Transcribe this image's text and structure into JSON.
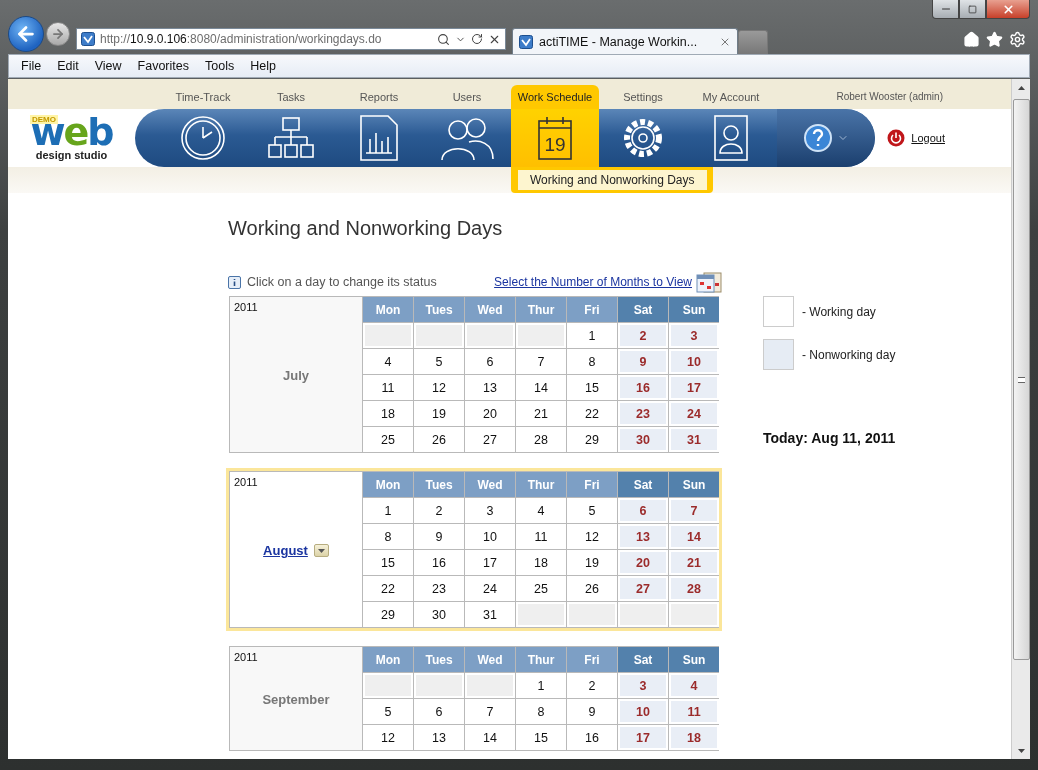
{
  "window": {
    "controls": [
      {
        "kind": "minimize"
      },
      {
        "kind": "maximize"
      },
      {
        "kind": "close"
      }
    ]
  },
  "browser": {
    "address": {
      "scheme": "http://",
      "host": "10.9.0.106",
      "path": ":8080/administration/workingdays.do"
    },
    "tabs": [
      {
        "title": "actiTIME - Manage Workin...",
        "selected": true
      }
    ],
    "menu": [
      "File",
      "Edit",
      "View",
      "Favorites",
      "Tools",
      "Help"
    ]
  },
  "app": {
    "logo": {
      "badge": "DEMO",
      "wordmark": "web",
      "subtitle": "design studio"
    },
    "nav": [
      {
        "label": "Time-Track",
        "kind": "clock",
        "selected": false
      },
      {
        "label": "Tasks",
        "kind": "hierarchy",
        "selected": false
      },
      {
        "label": "Reports",
        "kind": "chart",
        "selected": false
      },
      {
        "label": "Users",
        "kind": "people",
        "selected": false
      },
      {
        "label": "Work Schedule",
        "kind": "calendar",
        "icon_text": "19",
        "selected": true
      },
      {
        "label": "Settings",
        "kind": "gear",
        "selected": false
      },
      {
        "label": "My Account",
        "kind": "contact",
        "selected": false
      }
    ],
    "user": "Robert Wooster (admin)",
    "logout": "Logout",
    "submenu": "Working and Nonworking Days"
  },
  "page": {
    "title": "Working and Nonworking Days",
    "hint": "Click on a day to change its status",
    "months_link": "Select the Number of Months to View",
    "months": [
      {
        "year": "2011",
        "name": "July",
        "selected": false,
        "weekdays": [
          {
            "label": "Mon",
            "weekend": false
          },
          {
            "label": "Tues",
            "weekend": false
          },
          {
            "label": "Wed",
            "weekend": false
          },
          {
            "label": "Thur",
            "weekend": false
          },
          {
            "label": "Fri",
            "weekend": false
          },
          {
            "label": "Sat",
            "weekend": true
          },
          {
            "label": "Sun",
            "weekend": true
          }
        ],
        "weeks": [
          [
            {
              "kind": "blank"
            },
            {
              "kind": "blank"
            },
            {
              "kind": "blank"
            },
            {
              "kind": "blank"
            },
            {
              "kind": "day",
              "day": "1",
              "working": true
            },
            {
              "kind": "day",
              "day": "2",
              "working": false
            },
            {
              "kind": "day",
              "day": "3",
              "working": false
            }
          ],
          [
            {
              "kind": "day",
              "day": "4",
              "working": true
            },
            {
              "kind": "day",
              "day": "5",
              "working": true
            },
            {
              "kind": "day",
              "day": "6",
              "working": true
            },
            {
              "kind": "day",
              "day": "7",
              "working": true
            },
            {
              "kind": "day",
              "day": "8",
              "working": true
            },
            {
              "kind": "day",
              "day": "9",
              "working": false
            },
            {
              "kind": "day",
              "day": "10",
              "working": false
            }
          ],
          [
            {
              "kind": "day",
              "day": "11",
              "working": true
            },
            {
              "kind": "day",
              "day": "12",
              "working": true
            },
            {
              "kind": "day",
              "day": "13",
              "working": true
            },
            {
              "kind": "day",
              "day": "14",
              "working": true
            },
            {
              "kind": "day",
              "day": "15",
              "working": true
            },
            {
              "kind": "day",
              "day": "16",
              "working": false
            },
            {
              "kind": "day",
              "day": "17",
              "working": false
            }
          ],
          [
            {
              "kind": "day",
              "day": "18",
              "working": true
            },
            {
              "kind": "day",
              "day": "19",
              "working": true
            },
            {
              "kind": "day",
              "day": "20",
              "working": true
            },
            {
              "kind": "day",
              "day": "21",
              "working": true
            },
            {
              "kind": "day",
              "day": "22",
              "working": true
            },
            {
              "kind": "day",
              "day": "23",
              "working": false
            },
            {
              "kind": "day",
              "day": "24",
              "working": false
            }
          ],
          [
            {
              "kind": "day",
              "day": "25",
              "working": true
            },
            {
              "kind": "day",
              "day": "26",
              "working": true
            },
            {
              "kind": "day",
              "day": "27",
              "working": true
            },
            {
              "kind": "day",
              "day": "28",
              "working": true
            },
            {
              "kind": "day",
              "day": "29",
              "working": true
            },
            {
              "kind": "day",
              "day": "30",
              "working": false
            },
            {
              "kind": "day",
              "day": "31",
              "working": false
            }
          ]
        ]
      },
      {
        "year": "2011",
        "name": "August",
        "selected": true,
        "weekdays": [
          {
            "label": "Mon",
            "weekend": false
          },
          {
            "label": "Tues",
            "weekend": false
          },
          {
            "label": "Wed",
            "weekend": false
          },
          {
            "label": "Thur",
            "weekend": false
          },
          {
            "label": "Fri",
            "weekend": false
          },
          {
            "label": "Sat",
            "weekend": true
          },
          {
            "label": "Sun",
            "weekend": true
          }
        ],
        "weeks": [
          [
            {
              "kind": "day",
              "day": "1",
              "working": true
            },
            {
              "kind": "day",
              "day": "2",
              "working": true
            },
            {
              "kind": "day",
              "day": "3",
              "working": true
            },
            {
              "kind": "day",
              "day": "4",
              "working": true
            },
            {
              "kind": "day",
              "day": "5",
              "working": true
            },
            {
              "kind": "day",
              "day": "6",
              "working": false
            },
            {
              "kind": "day",
              "day": "7",
              "working": false
            }
          ],
          [
            {
              "kind": "day",
              "day": "8",
              "working": true
            },
            {
              "kind": "day",
              "day": "9",
              "working": true
            },
            {
              "kind": "day",
              "day": "10",
              "working": true
            },
            {
              "kind": "day",
              "day": "11",
              "working": true
            },
            {
              "kind": "day",
              "day": "12",
              "working": true
            },
            {
              "kind": "day",
              "day": "13",
              "working": false
            },
            {
              "kind": "day",
              "day": "14",
              "working": false
            }
          ],
          [
            {
              "kind": "day",
              "day": "15",
              "working": true
            },
            {
              "kind": "day",
              "day": "16",
              "working": true
            },
            {
              "kind": "day",
              "day": "17",
              "working": true
            },
            {
              "kind": "day",
              "day": "18",
              "working": true
            },
            {
              "kind": "day",
              "day": "19",
              "working": true
            },
            {
              "kind": "day",
              "day": "20",
              "working": false
            },
            {
              "kind": "day",
              "day": "21",
              "working": false
            }
          ],
          [
            {
              "kind": "day",
              "day": "22",
              "working": true
            },
            {
              "kind": "day",
              "day": "23",
              "working": true
            },
            {
              "kind": "day",
              "day": "24",
              "working": true
            },
            {
              "kind": "day",
              "day": "25",
              "working": true
            },
            {
              "kind": "day",
              "day": "26",
              "working": true
            },
            {
              "kind": "day",
              "day": "27",
              "working": false
            },
            {
              "kind": "day",
              "day": "28",
              "working": false
            }
          ],
          [
            {
              "kind": "day",
              "day": "29",
              "working": true
            },
            {
              "kind": "day",
              "day": "30",
              "working": true
            },
            {
              "kind": "day",
              "day": "31",
              "working": true
            },
            {
              "kind": "blank"
            },
            {
              "kind": "blank"
            },
            {
              "kind": "blank"
            },
            {
              "kind": "blank"
            }
          ]
        ]
      },
      {
        "year": "2011",
        "name": "September",
        "selected": false,
        "weekdays": [
          {
            "label": "Mon",
            "weekend": false
          },
          {
            "label": "Tues",
            "weekend": false
          },
          {
            "label": "Wed",
            "weekend": false
          },
          {
            "label": "Thur",
            "weekend": false
          },
          {
            "label": "Fri",
            "weekend": false
          },
          {
            "label": "Sat",
            "weekend": true
          },
          {
            "label": "Sun",
            "weekend": true
          }
        ],
        "weeks": [
          [
            {
              "kind": "blank"
            },
            {
              "kind": "blank"
            },
            {
              "kind": "blank"
            },
            {
              "kind": "day",
              "day": "1",
              "working": true
            },
            {
              "kind": "day",
              "day": "2",
              "working": true
            },
            {
              "kind": "day",
              "day": "3",
              "working": false
            },
            {
              "kind": "day",
              "day": "4",
              "working": false
            }
          ],
          [
            {
              "kind": "day",
              "day": "5",
              "working": true
            },
            {
              "kind": "day",
              "day": "6",
              "working": true
            },
            {
              "kind": "day",
              "day": "7",
              "working": true
            },
            {
              "kind": "day",
              "day": "8",
              "working": true
            },
            {
              "kind": "day",
              "day": "9",
              "working": true
            },
            {
              "kind": "day",
              "day": "10",
              "working": false
            },
            {
              "kind": "day",
              "day": "11",
              "working": false
            }
          ],
          [
            {
              "kind": "day",
              "day": "12",
              "working": true
            },
            {
              "kind": "day",
              "day": "13",
              "working": true
            },
            {
              "kind": "day",
              "day": "14",
              "working": true
            },
            {
              "kind": "day",
              "day": "15",
              "working": true
            },
            {
              "kind": "day",
              "day": "16",
              "working": true
            },
            {
              "kind": "day",
              "day": "17",
              "working": false
            },
            {
              "kind": "day",
              "day": "18",
              "working": false
            }
          ]
        ]
      }
    ],
    "legend": [
      {
        "label": "- Working day",
        "working": true
      },
      {
        "label": "- Nonworking day",
        "working": false
      }
    ],
    "today": "Today: Aug 11, 2011"
  }
}
